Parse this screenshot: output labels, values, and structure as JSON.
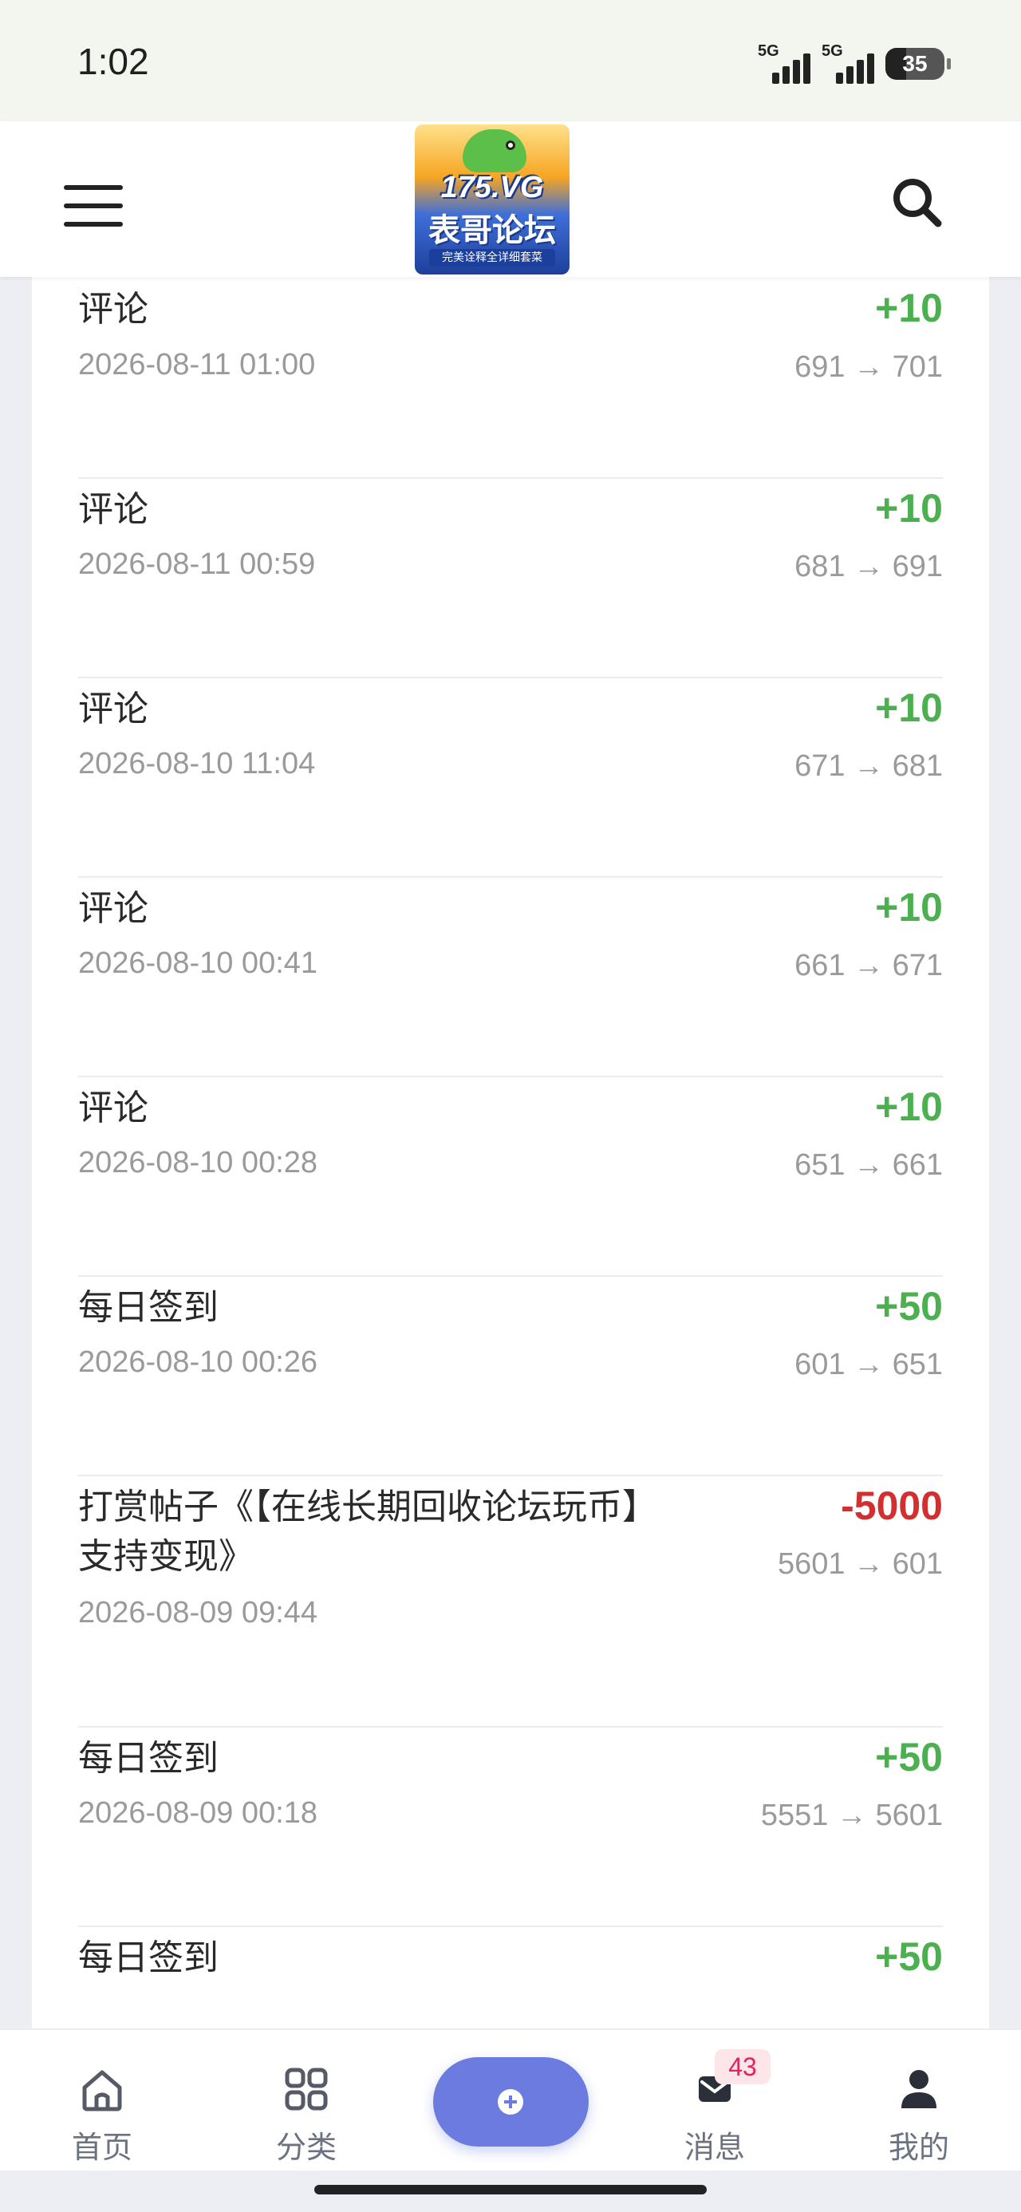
{
  "status_bar": {
    "time": "1:02",
    "signal1_label": "5G",
    "signal2_label": "5G",
    "battery": "35"
  },
  "header": {
    "logo_line1": "175.VG",
    "logo_line2": "表哥论坛",
    "logo_line3": "完美诠释全详细套菜"
  },
  "transactions": [
    {
      "title": "评论",
      "time": "2026-08-11 01:00",
      "amount": "+10",
      "change": "691 → 701",
      "sign": "pos"
    },
    {
      "title": "评论",
      "time": "2026-08-11 00:59",
      "amount": "+10",
      "change": "681 → 691",
      "sign": "pos"
    },
    {
      "title": "评论",
      "time": "2026-08-10 11:04",
      "amount": "+10",
      "change": "671 → 681",
      "sign": "pos"
    },
    {
      "title": "评论",
      "time": "2026-08-10 00:41",
      "amount": "+10",
      "change": "661 → 671",
      "sign": "pos"
    },
    {
      "title": "评论",
      "time": "2026-08-10 00:28",
      "amount": "+10",
      "change": "651 → 661",
      "sign": "pos"
    },
    {
      "title": "每日签到",
      "time": "2026-08-10 00:26",
      "amount": "+50",
      "change": "601 → 651",
      "sign": "pos"
    },
    {
      "title_line1": "打赏帖子《【在线长期回收论坛玩币】",
      "title_line2": "支持变现》",
      "time": "2026-08-09 09:44",
      "amount": "-5000",
      "change": "5601 → 601",
      "sign": "neg"
    },
    {
      "title": "每日签到",
      "time": "2026-08-09 00:18",
      "amount": "+50",
      "change": "5551 → 5601",
      "sign": "pos"
    },
    {
      "title": "每日签到",
      "amount": "+50",
      "sign": "pos"
    }
  ],
  "bottom_nav": {
    "home": "首页",
    "category": "分类",
    "messages": "消息",
    "messages_badge": "43",
    "profile": "我的"
  },
  "colors": {
    "positive": "#4caf50",
    "negative": "#d32f2f",
    "fab": "#6b7be0"
  }
}
